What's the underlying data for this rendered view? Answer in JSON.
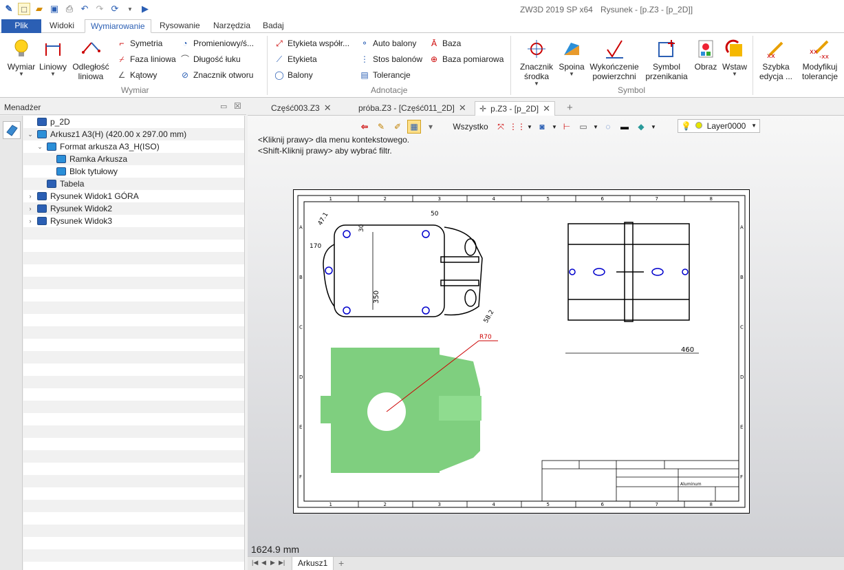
{
  "window": {
    "app_title": "ZW3D 2019 SP x64",
    "doc_title": "Rysunek - [p.Z3 - [p_2D]]"
  },
  "ribbon_tabs": [
    "Plik",
    "Widoki",
    "Wymiarowanie",
    "Rysowanie",
    "Narzędzia",
    "Badaj"
  ],
  "ribbon": {
    "wymiar": {
      "big": [
        "Wymiar",
        "Liniowy",
        "Odległość liniowa"
      ],
      "small": [
        "Symetria",
        "Faza liniowa",
        "Kątowy",
        "Promieniowy/ś...",
        "Długość łuku",
        "Znacznik otworu"
      ],
      "group": "Wymiar"
    },
    "adnotacje": {
      "small": [
        "Etykieta współr...",
        "Etykieta",
        "Balony",
        "Auto balony",
        "Stos balonów",
        "Tolerancje",
        "Baza",
        "Baza pomiarowa"
      ],
      "group": "Adnotacje"
    },
    "symbol": {
      "big": [
        "Znacznik środka",
        "Spoina",
        "Wykończenie powierzchni",
        "Symbol przenikania",
        "Obraz",
        "Wstaw"
      ],
      "group": "Symbol"
    },
    "extra": {
      "big": [
        "Szybka edycja ...",
        "Modyfikuj tolerancje"
      ]
    }
  },
  "manager": {
    "title": "Menadżer",
    "tree": [
      {
        "label": "p_2D",
        "level": 0,
        "toggle": "",
        "icon": "part-icon"
      },
      {
        "label": "Arkusz1 A3(H) (420.00 x 297.00 mm)",
        "level": 0,
        "toggle": "v",
        "icon": "sheet-icon"
      },
      {
        "label": "Format arkusza A3_H(ISO)",
        "level": 1,
        "toggle": "v",
        "icon": "format-icon"
      },
      {
        "label": "Ramka Arkusza",
        "level": 2,
        "toggle": "",
        "icon": "frame-icon"
      },
      {
        "label": "Blok tytułowy",
        "level": 2,
        "toggle": "",
        "icon": "title-block-icon"
      },
      {
        "label": "Tabela",
        "level": 1,
        "toggle": "",
        "icon": "table-icon"
      },
      {
        "label": "Rysunek Widok1 GÓRA",
        "level": 0,
        "toggle": ">",
        "icon": "view-icon"
      },
      {
        "label": "Rysunek Widok2",
        "level": 0,
        "toggle": ">",
        "icon": "view-icon"
      },
      {
        "label": "Rysunek Widok3",
        "level": 0,
        "toggle": ">",
        "icon": "view-icon"
      }
    ]
  },
  "doc_tabs": [
    {
      "label": "Część003.Z3",
      "active": false
    },
    {
      "label": "próba.Z3 - [Część011_2D]",
      "active": false
    },
    {
      "label": "p.Z3 - [p_2D]",
      "active": true
    }
  ],
  "canvas": {
    "filter_label": "Wszystko",
    "layer": "Layer0000",
    "hint1": "<Kliknij prawy> dla menu kontekstowego.",
    "hint2": "<Shift-Kliknij prawy> aby wybrać filtr.",
    "measurement": "1624.9 mm"
  },
  "drawing": {
    "col_labels": [
      "1",
      "2",
      "3",
      "4",
      "5",
      "6",
      "7",
      "8"
    ],
    "row_labels": [
      "A",
      "B",
      "C",
      "D",
      "E",
      "F"
    ],
    "dims": [
      "47.1",
      "30",
      "50",
      "170",
      "350",
      "58.2",
      "R70",
      "460"
    ],
    "title_block_material": "Aluminum"
  },
  "sheet_tab": "Arkusz1",
  "colors": {
    "accent": "#2b5fb4",
    "model_green": "#7fcf7f",
    "dim_red": "#cc0000"
  }
}
